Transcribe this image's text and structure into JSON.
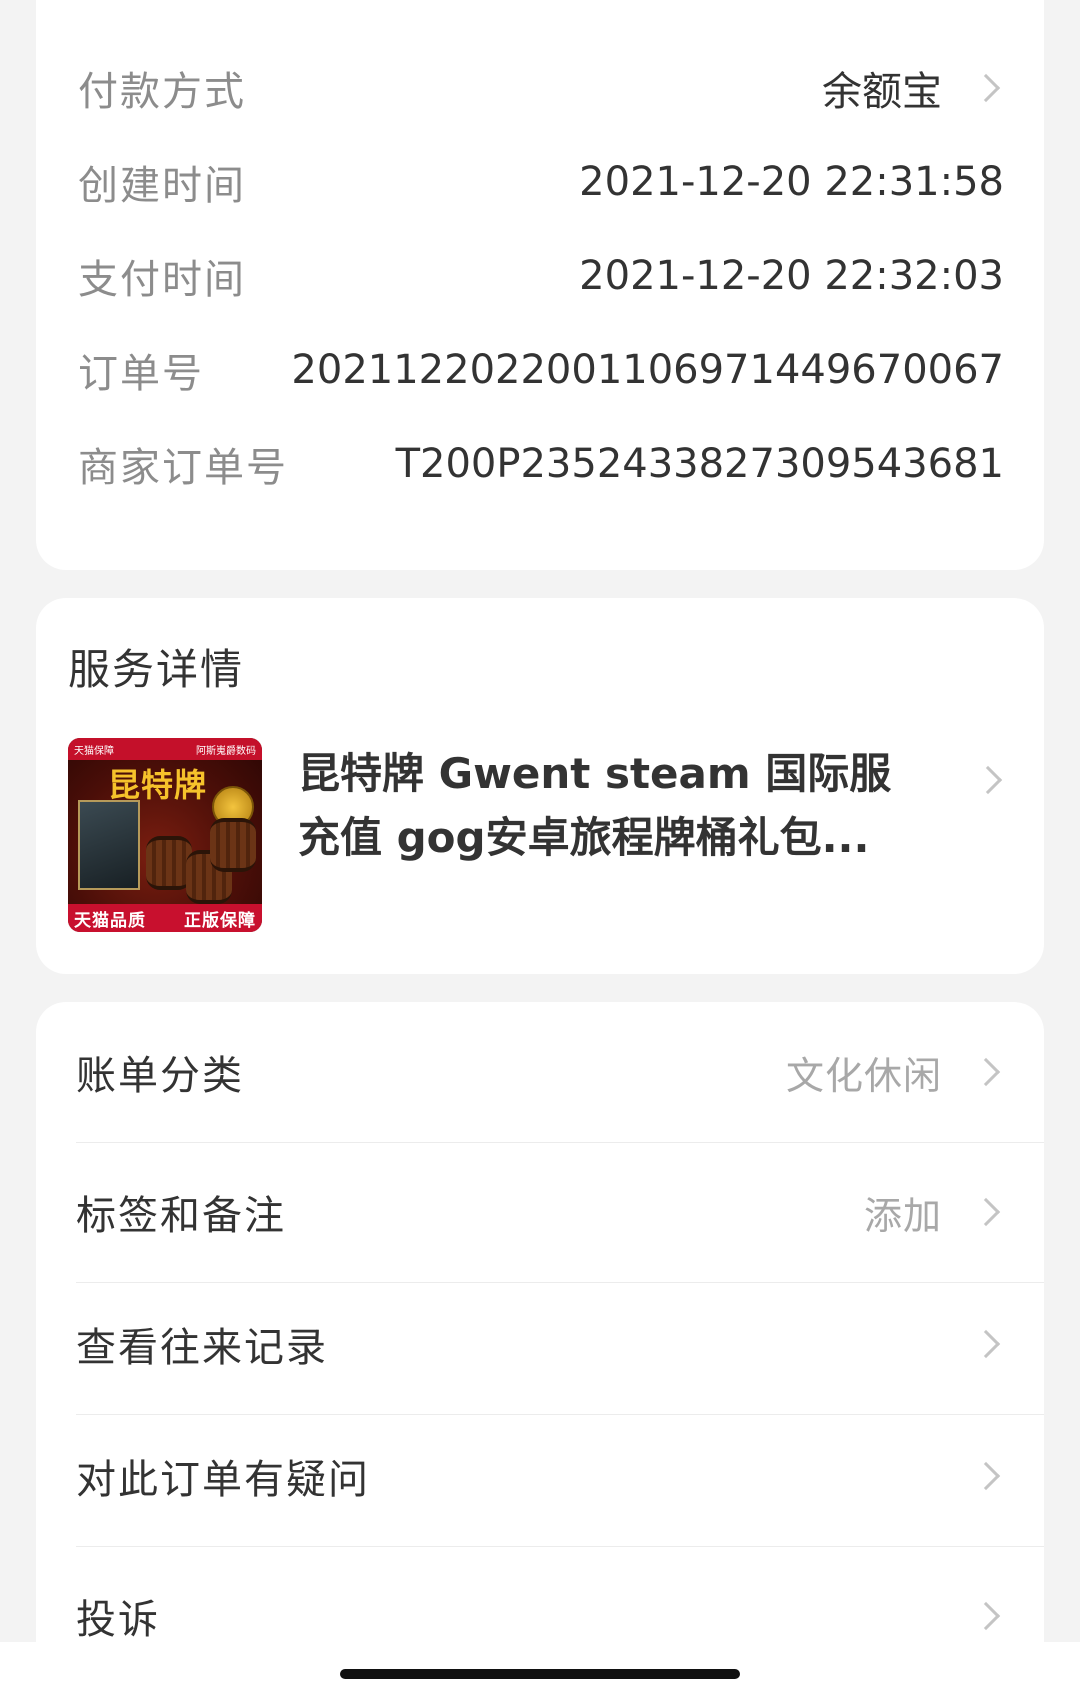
{
  "order_info": {
    "rows": [
      {
        "label": "付款方式",
        "value": "余额宝"
      },
      {
        "label": "创建时间",
        "value": "2021-12-20 22:31:58"
      },
      {
        "label": "支付时间",
        "value": "2021-12-20 22:32:03"
      },
      {
        "label": "订单号",
        "value": "2021122022001106971449670067"
      },
      {
        "label": "商家订单号",
        "value": "T200P2352433827309543681"
      }
    ]
  },
  "service": {
    "title": "服务详情",
    "product": {
      "title": "昆特牌 Gwent steam 国际服充值 gog安卓旅程牌桶礼包...",
      "thumb_top_left": "天猫保障",
      "thumb_top_right": "阿斯嵬爵数码",
      "thumb_title": "昆特牌",
      "thumb_badge_left": "天猫品质",
      "thumb_badge_right": "正版保障"
    }
  },
  "actions": [
    {
      "label": "账单分类",
      "value": "文化休闲"
    },
    {
      "label": "标签和备注",
      "value": "添加"
    },
    {
      "label": "查看往来记录",
      "value": ""
    },
    {
      "label": "对此订单有疑问",
      "value": ""
    },
    {
      "label": "投诉",
      "value": ""
    }
  ],
  "colors": {
    "background": "#f3f3f3",
    "card": "#ffffff",
    "label_grey": "#8c8c8c",
    "text": "#333333",
    "chevron": "#c4c4c4",
    "brand_red": "#c8102e"
  },
  "icons": {
    "row_chevron": "chevron-right-icon"
  }
}
